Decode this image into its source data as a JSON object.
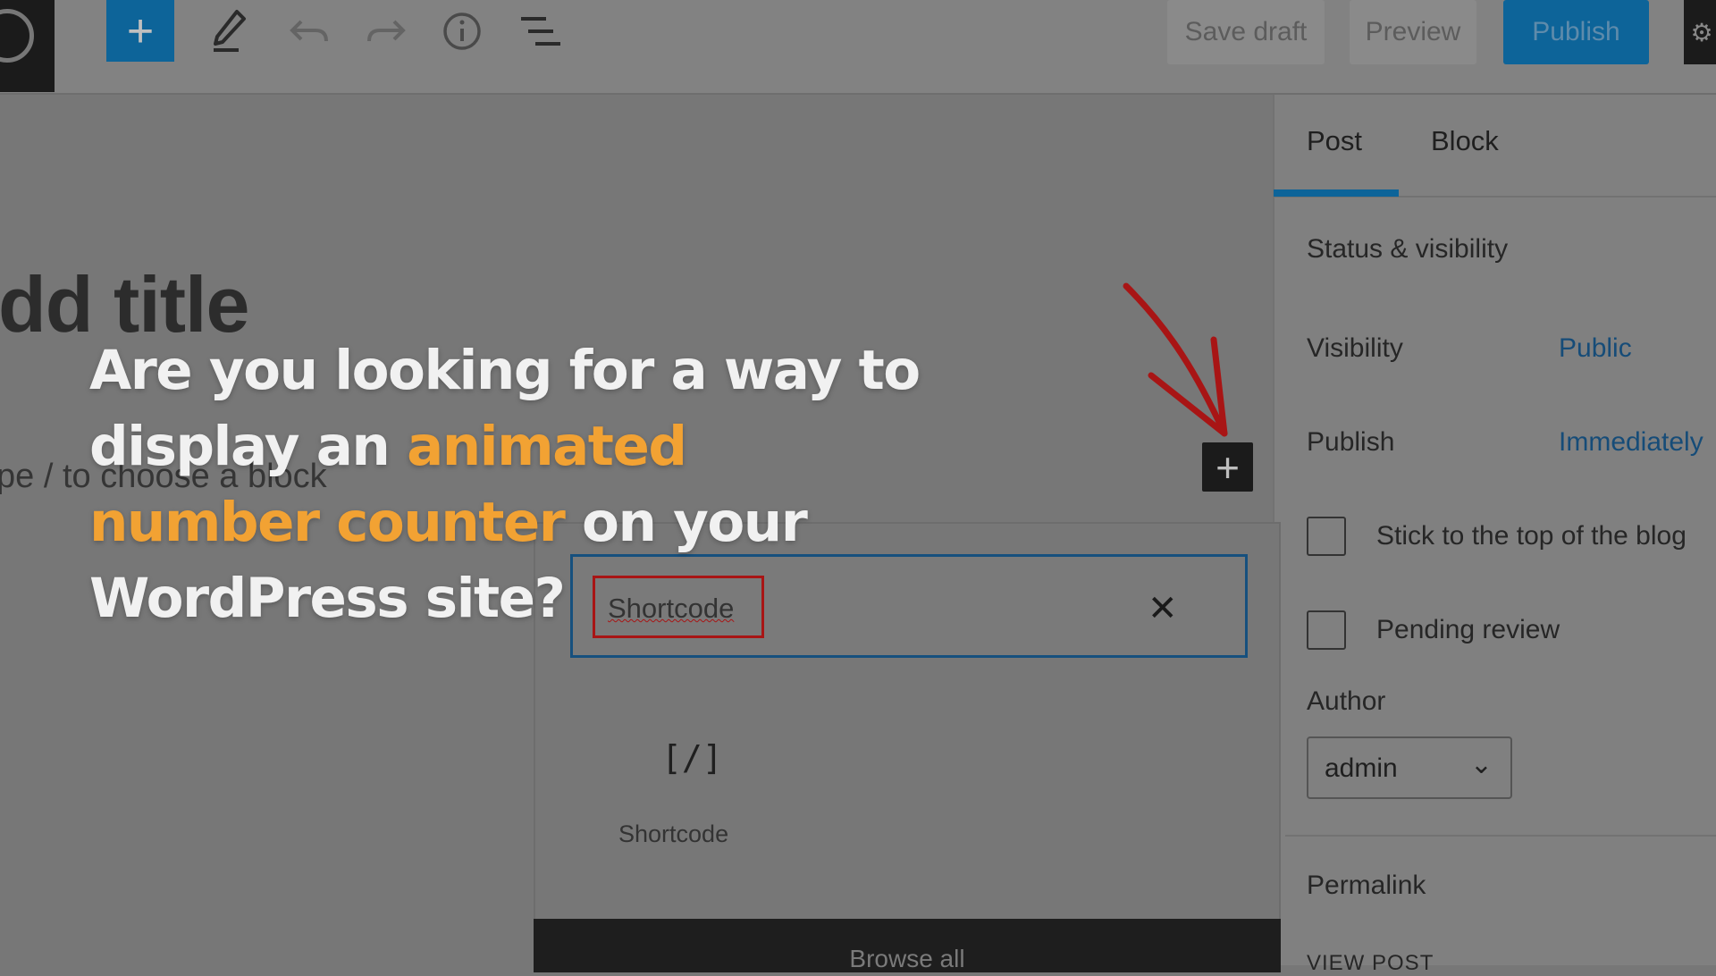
{
  "toolbar": {
    "save_draft": "Save draft",
    "preview": "Preview",
    "publish": "Publish",
    "icons": [
      "wordpress-icon",
      "plus-icon",
      "pencil-icon",
      "undo-icon",
      "redo-icon",
      "info-icon",
      "list-view-icon",
      "settings-icon"
    ]
  },
  "editor": {
    "title_placeholder": "dd title",
    "block_placeholder": "pe / to choose a block"
  },
  "inserter": {
    "search_value": "Shortcode",
    "result_icon_glyph": "[/]",
    "result_label": "Shortcode",
    "browse_all": "Browse all"
  },
  "sidebar": {
    "tabs": [
      {
        "label": "Post",
        "active": true
      },
      {
        "label": "Block",
        "active": false
      }
    ],
    "panel_title": "Status & visibility",
    "visibility_label": "Visibility",
    "visibility_value": "Public",
    "publish_label": "Publish",
    "publish_value": "Immediately",
    "stick_label": "Stick to the top of the blog",
    "pending_label": "Pending review",
    "author_label": "Author",
    "author_value": "admin",
    "permalink_label": "Permalink",
    "view_post": "VIEW POST"
  },
  "caption": {
    "line1": "Are you looking for a way to",
    "line2_plain": "display an ",
    "line2_highlight": "animated",
    "line3_highlight": "number counter",
    "line3_plain": " on your",
    "line4": "WordPress site?"
  },
  "colors": {
    "accent_blue": "#0d6499",
    "highlight_orange": "#f2a233",
    "annotation_red": "#a81515"
  }
}
